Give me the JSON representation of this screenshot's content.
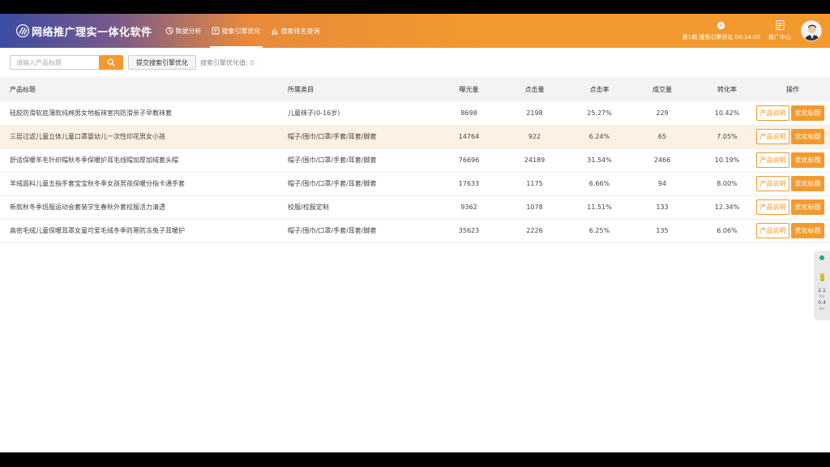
{
  "app": {
    "title": "网络推广理实一体化软件"
  },
  "nav": {
    "items": [
      {
        "label": "数据分析",
        "icon": "chart-icon",
        "active": false
      },
      {
        "label": "搜索引擎优化",
        "icon": "seo-icon",
        "active": true
      },
      {
        "label": "搜索排名查询",
        "icon": "rank-icon",
        "active": false
      }
    ]
  },
  "header": {
    "timer_text": "第1期 搜索引擎优化 00:14:00",
    "report_label": "推广中心"
  },
  "toolbar": {
    "search_placeholder": "请输入产品标题",
    "submit_label": "提交搜索引擎优化",
    "score_label": "搜索引擎优化值:",
    "score_value": "0"
  },
  "table": {
    "headers": [
      "产品标题",
      "所属类目",
      "曝光量",
      "点击量",
      "点击率",
      "成交量",
      "转化率",
      "操作"
    ],
    "desc_label": "产品说明",
    "opt_label": "优化标题",
    "rows": [
      {
        "title": "硅胶防滑软底薄款纯棉男女地板袜室内防滑亲子早教袜套",
        "category": "儿童袜子(0-16岁)",
        "exposure": "8698",
        "clicks": "2198",
        "ctr": "25.27%",
        "deals": "229",
        "conversion": "10.42%"
      },
      {
        "title": "三层过滤儿童立体儿童口罩婴幼儿一次性印花男女小孩",
        "category": "帽子/围巾/口罩/手套/耳套/脚套",
        "exposure": "14764",
        "clicks": "922",
        "ctr": "6.24%",
        "deals": "65",
        "conversion": "7.05%"
      },
      {
        "title": "舒适保暖羊毛针织帽秋冬季保暖护耳毛线帽加厚加绒套头帽",
        "category": "帽子/围巾/口罩/手套/耳套/脚套",
        "exposure": "76696",
        "clicks": "24189",
        "ctr": "31.54%",
        "deals": "2466",
        "conversion": "10.19%"
      },
      {
        "title": "羊绒面料儿童五指手套宝宝秋冬季女孩男孩保暖分指卡通手套",
        "category": "帽子/围巾/口罩/手套/耳套/脚套",
        "exposure": "17633",
        "clicks": "1175",
        "ctr": "6.66%",
        "deals": "94",
        "conversion": "8.00%"
      },
      {
        "title": "新款秋冬季班服运动会套装学生春秋外套校服活力清透",
        "category": "校服/校服定制",
        "exposure": "9362",
        "clicks": "1078",
        "ctr": "11.51%",
        "deals": "133",
        "conversion": "12.34%"
      },
      {
        "title": "高密毛绒儿童保暖耳罩女童可爱毛绒冬季防寒防冻兔子耳暖护",
        "category": "帽子/围巾/口罩/手套/耳套/脚套",
        "exposure": "35623",
        "clicks": "2226",
        "ctr": "6.25%",
        "deals": "135",
        "conversion": "6.06%"
      }
    ]
  },
  "side_widget": {
    "upload": "2.1",
    "upload_unit": "K/s",
    "download": "0.4",
    "download_unit": "K/s"
  },
  "colors": {
    "accent": "#f39a2e",
    "highlight_row": "#fcf1e3",
    "header_bg": "#f3f3f3"
  }
}
